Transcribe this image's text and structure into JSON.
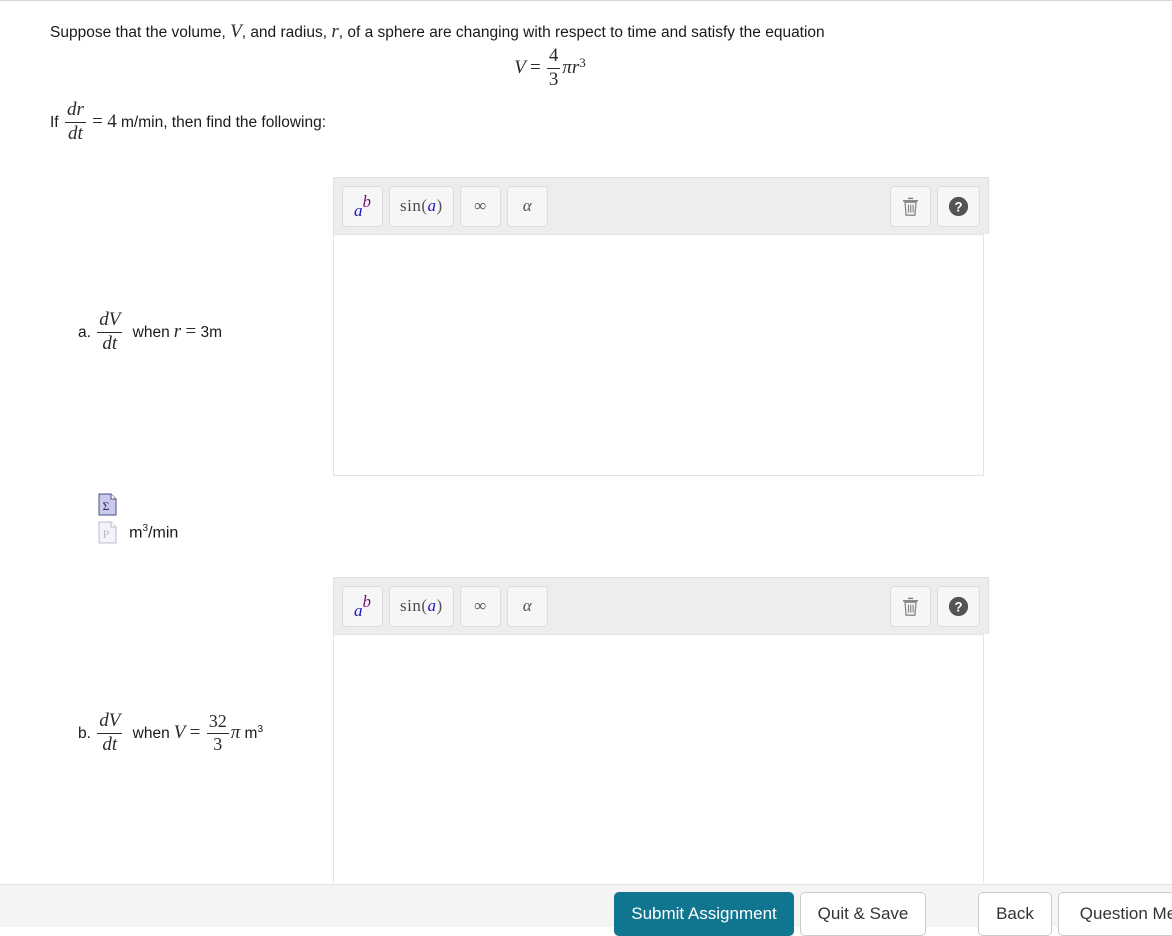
{
  "prompt": {
    "intro_before_v": "Suppose that the volume, ",
    "var_v": "V",
    "intro_mid": ",  and radius, ",
    "var_r": "r",
    "intro_after": ",  of a sphere are changing with respect to time and satisfy the equation",
    "equation": {
      "lhs": "V",
      "equals": "=",
      "frac_num": "4",
      "frac_den": "3",
      "pi": "π",
      "r": "r",
      "exponent": "3"
    },
    "given": {
      "if_word": "If",
      "frac_num": "dr",
      "frac_den": "dt",
      "equals": "=",
      "value": "4",
      "units_and_rest": " m/min, then find the following:"
    }
  },
  "parts": [
    {
      "letter": "a.",
      "frac_num": "dV",
      "frac_den": "dt",
      "when": "when",
      "variable": "r",
      "equals": "=",
      "value": "3m"
    },
    {
      "letter": "b.",
      "frac_num": "dV",
      "frac_den": "dt",
      "when": "when",
      "variable": "V",
      "equals": "=",
      "value_num": "32",
      "value_den": "3",
      "pi": "π",
      "unit": "m",
      "unit_exp": "3"
    }
  ],
  "math_toolbar": {
    "tools": [
      {
        "id": "exponent",
        "icon": "superscript-icon",
        "a": "a",
        "b": "b"
      },
      {
        "id": "trig",
        "icon": "sine-function-icon",
        "prefix": "sin",
        "open": "(",
        "arg": "a",
        "close": ")"
      },
      {
        "id": "infinity",
        "icon": "infinity-icon",
        "glyph": "∞"
      },
      {
        "id": "greek",
        "icon": "alpha-icon",
        "glyph": "α"
      }
    ],
    "clear_label": "Clear",
    "clear_icon": "trash-icon",
    "help_label": "Help",
    "help_icon": "question-mark-circle-icon"
  },
  "answers": {
    "a": {
      "value": "",
      "placeholder": ""
    },
    "b": {
      "value": "",
      "placeholder": ""
    }
  },
  "broken_images": {
    "sigma": {
      "icon": "broken-image-icon",
      "glyph": "Σ"
    },
    "preview": {
      "icon": "broken-image-icon",
      "glyph": "P"
    },
    "unit_text": "m",
    "unit_exp": "3",
    "unit_suffix": "/min"
  },
  "bottom_bar": {
    "submit_label": "Submit Assignment",
    "quit_label": "Quit & Save",
    "back_label": "Back",
    "question_menu_label": "Question Me"
  },
  "colors": {
    "primary_teal": "#10758e",
    "toolbar_bg": "#ededed",
    "bottom_bar_bg": "#f4f4f4",
    "math_blue": "#1414c8",
    "math_purple": "#7a0f7a"
  }
}
